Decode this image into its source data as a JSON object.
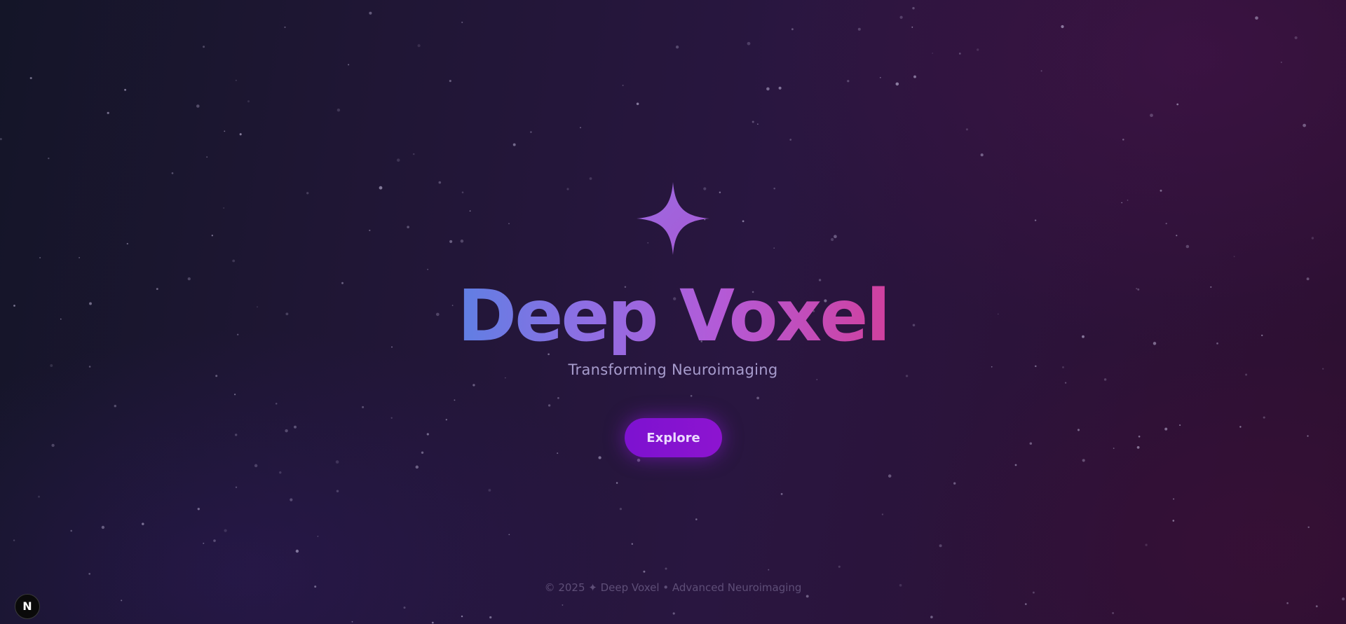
{
  "hero": {
    "title": "Deep Voxel",
    "subtitle": "Transforming Neuroimaging",
    "icon": "sparkle-icon"
  },
  "actions": {
    "explore_label": "Explore"
  },
  "footer": {
    "text": "© 2025 ✦ Deep Voxel • Advanced Neuroimaging"
  },
  "dev_badge": {
    "label": "N",
    "icon": "nextjs-logo-icon"
  },
  "colors": {
    "accent": "#8412d0",
    "title_gradient_start": "#5f7fe3",
    "title_gradient_end": "#d0409e",
    "sparkle": "#a062dc",
    "subtitle": "#a79ccd",
    "footer": "#5e4e77"
  }
}
